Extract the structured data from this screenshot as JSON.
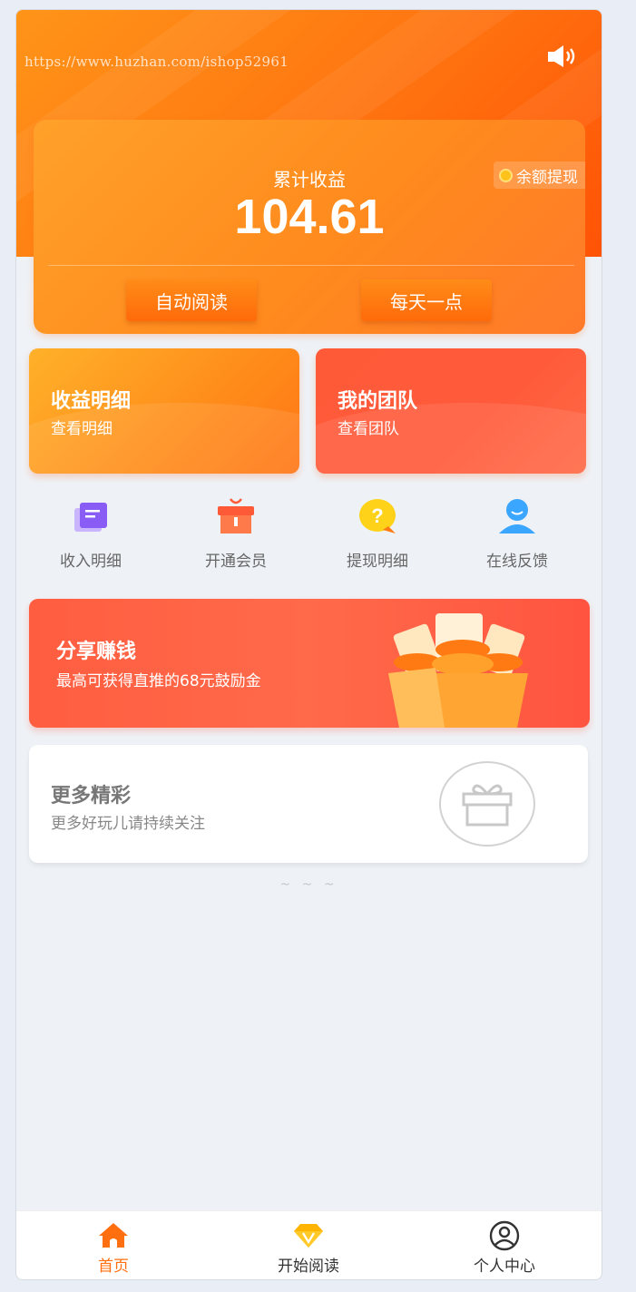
{
  "header": {
    "watermark": "https://www.huzhan.com/ishop52961",
    "speaker_icon": "speaker-icon"
  },
  "earnings": {
    "label": "累计收益",
    "value": "104.61",
    "withdraw_label": "余额提现",
    "auto_read_label": "自动阅读",
    "daily_label": "每天一点"
  },
  "cards": {
    "income": {
      "title": "收益明细",
      "subtitle": "查看明细"
    },
    "team": {
      "title": "我的团队",
      "subtitle": "查看团队"
    }
  },
  "shortcuts": [
    {
      "label": "收入明细",
      "icon": "document-icon"
    },
    {
      "label": "开通会员",
      "icon": "gift-box-icon"
    },
    {
      "label": "提现明细",
      "icon": "question-bubble-icon"
    },
    {
      "label": "在线反馈",
      "icon": "user-support-icon"
    }
  ],
  "share": {
    "title": "分享赚钱",
    "subtitle": "最高可获得直推的68元鼓励金"
  },
  "more": {
    "title": "更多精彩",
    "subtitle": "更多好玩儿请持续关注"
  },
  "footer_tilde": "~ ~ ~",
  "tabbar": [
    {
      "label": "首页",
      "icon": "home-icon",
      "active": true
    },
    {
      "label": "开始阅读",
      "icon": "diamond-icon",
      "active": false
    },
    {
      "label": "个人中心",
      "icon": "profile-icon",
      "active": false
    }
  ],
  "colors": {
    "accent": "#ff7a12",
    "accent_dark": "#ff5306",
    "team_red": "#ff5a38",
    "active_tab": "#ff6f10"
  }
}
